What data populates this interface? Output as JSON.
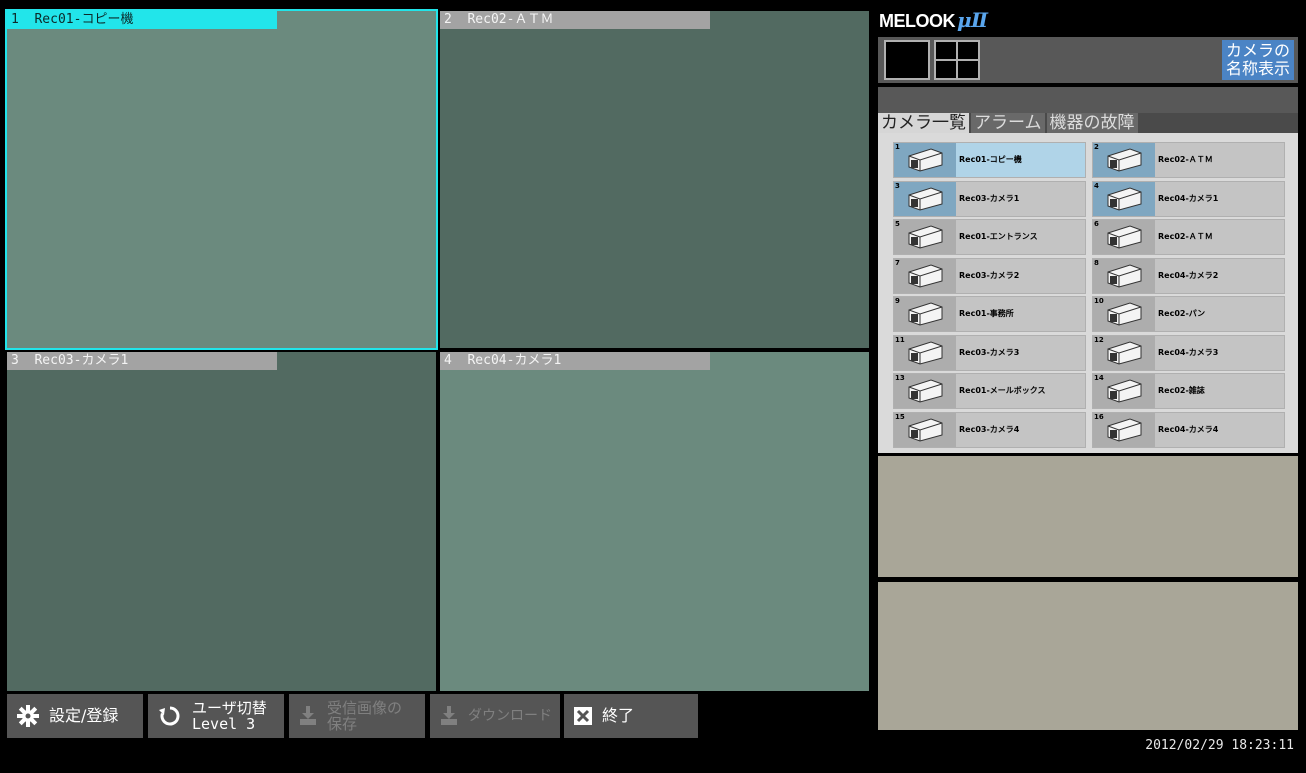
{
  "views": [
    {
      "num": "1",
      "label": "Rec01-コピー機"
    },
    {
      "num": "2",
      "label": "Rec02-ＡＴＭ"
    },
    {
      "num": "3",
      "label": "Rec03-カメラ1"
    },
    {
      "num": "4",
      "label": "Rec04-カメラ1"
    }
  ],
  "toolbar": {
    "settings": "設定/登録",
    "user_switch": "ユーザ切替",
    "user_level": "Level 3",
    "save_line1": "受信画像の",
    "save_line2": "保存",
    "download": "ダウンロード",
    "exit": "終了"
  },
  "panel": {
    "logo_text": "MELOOK",
    "logo_mu": "μⅡ",
    "name_display_line1": "カメラの",
    "name_display_line2": "名称表示",
    "tabs": [
      "カメラ一覧",
      "アラーム",
      "機器の故障"
    ]
  },
  "cameras": [
    {
      "num": "1",
      "name": "Rec01-コピー機"
    },
    {
      "num": "2",
      "name": "Rec02-ＡＴＭ"
    },
    {
      "num": "3",
      "name": "Rec03-カメラ1"
    },
    {
      "num": "4",
      "name": "Rec04-カメラ1"
    },
    {
      "num": "5",
      "name": "Rec01-エントランス"
    },
    {
      "num": "6",
      "name": "Rec02-ＡＴＭ"
    },
    {
      "num": "7",
      "name": "Rec03-カメラ2"
    },
    {
      "num": "8",
      "name": "Rec04-カメラ2"
    },
    {
      "num": "9",
      "name": "Rec01-事務所"
    },
    {
      "num": "10",
      "name": "Rec02-パン"
    },
    {
      "num": "11",
      "name": "Rec03-カメラ3"
    },
    {
      "num": "12",
      "name": "Rec04-カメラ3"
    },
    {
      "num": "13",
      "name": "Rec01-メールボックス"
    },
    {
      "num": "14",
      "name": "Rec02-雑誌"
    },
    {
      "num": "15",
      "name": "Rec03-カメラ4"
    },
    {
      "num": "16",
      "name": "Rec04-カメラ4"
    }
  ],
  "datetime": "2012/02/29 18:23:11",
  "colors": {
    "selection": "#22e5ea",
    "video_light": "#6b8a7e",
    "video_dark": "#526a61",
    "accent_button": "#4b84c5",
    "info_panel": "#a9a698"
  }
}
